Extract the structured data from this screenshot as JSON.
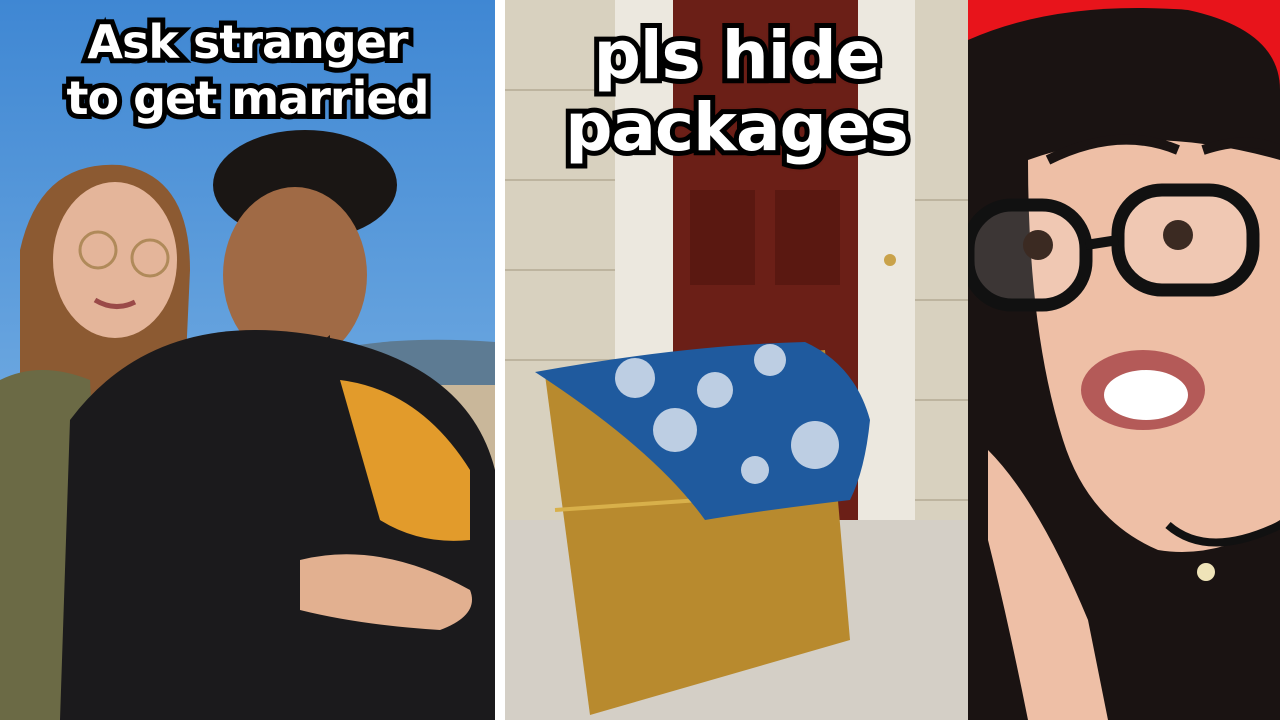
{
  "left_panel": {
    "caption_lines": [
      "Ask stranger",
      "to get married"
    ]
  },
  "middle_panel": {
    "caption_lines": [
      "pls hide",
      "packages"
    ]
  },
  "colors": {
    "divider": "#ffffff",
    "caption_text": "#ffffff",
    "caption_outline": "#000000",
    "right_background": "#e8141b",
    "sky": "#4a93d8",
    "door": "#6b1f17",
    "gift_wrap": "#1f5a9e",
    "box": "#b88a2e"
  }
}
